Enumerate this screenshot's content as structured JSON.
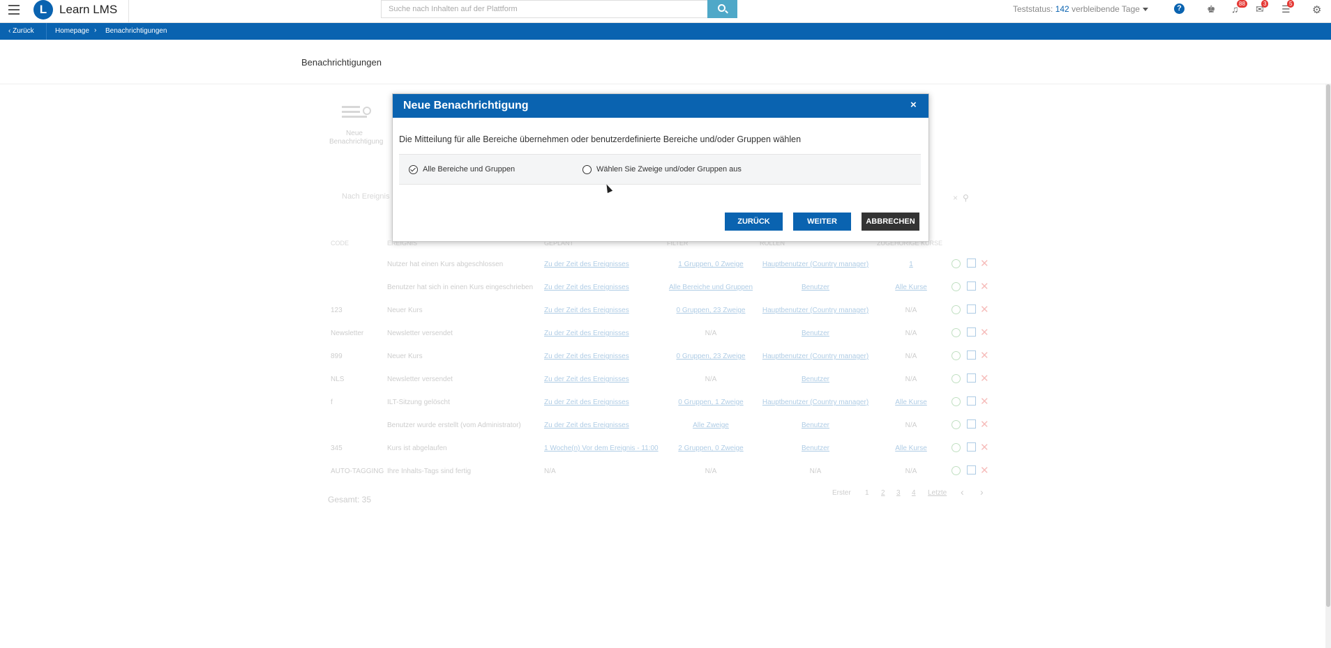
{
  "app": {
    "logo_letter": "L",
    "name": "Learn LMS"
  },
  "search": {
    "placeholder": "Suche nach Inhalten auf der Plattform"
  },
  "trial": {
    "prefix": "Teststatus:",
    "days": "142",
    "suffix": "verbleibende Tage"
  },
  "header_icons": {
    "help": "?",
    "trophy": "trophy-icon",
    "notifications_badge": "88",
    "chat_badge": "3",
    "messages_badge": "5"
  },
  "breadcrumb": {
    "back": "Zurück",
    "home": "Homepage",
    "current": "Benachrichtigungen"
  },
  "page": {
    "title": "Benachrichtigungen",
    "new_label": "Neue Benachrichtigung",
    "filter_placeholder": "Nach Ereignis"
  },
  "table": {
    "headers": [
      "CODE",
      "EREIGNIS",
      "GEPLANT",
      "FILTER",
      "ROLLEN",
      "ZUGEHÖRIGE KURSE"
    ],
    "rows": [
      {
        "code": "",
        "event": "Nutzer hat einen Kurs abgeschlossen",
        "scheduled": "Zu der Zeit des Ereignisses",
        "filter": "1 Gruppen, 0 Zweige",
        "roles": "Hauptbenutzer (Country manager)",
        "courses": "1"
      },
      {
        "code": "",
        "event": "Benutzer hat sich in einen Kurs eingeschrieben",
        "scheduled": "Zu der Zeit des Ereignisses",
        "filter": "Alle Bereiche und Gruppen",
        "roles": "Benutzer",
        "courses": "Alle Kurse"
      },
      {
        "code": "123",
        "event": "Neuer Kurs",
        "scheduled": "Zu der Zeit des Ereignisses",
        "filter": "0 Gruppen, 23 Zweige",
        "roles": "Hauptbenutzer (Country manager)",
        "courses": "N/A"
      },
      {
        "code": "Newsletter",
        "event": "Newsletter versendet",
        "scheduled": "Zu der Zeit des Ereignisses",
        "filter": "N/A",
        "roles": "Benutzer",
        "courses": "N/A"
      },
      {
        "code": "899",
        "event": "Neuer Kurs",
        "scheduled": "Zu der Zeit des Ereignisses",
        "filter": "0 Gruppen, 23 Zweige",
        "roles": "Hauptbenutzer (Country manager)",
        "courses": "N/A"
      },
      {
        "code": "NLS",
        "event": "Newsletter versendet",
        "scheduled": "Zu der Zeit des Ereignisses",
        "filter": "N/A",
        "roles": "Benutzer",
        "courses": "N/A"
      },
      {
        "code": "f",
        "event": "ILT-Sitzung gelöscht",
        "scheduled": "Zu der Zeit des Ereignisses",
        "filter": "0 Gruppen, 1 Zweige",
        "roles": "Hauptbenutzer (Country manager)",
        "courses": "Alle Kurse"
      },
      {
        "code": "",
        "event": "Benutzer wurde erstellt (vom Administrator)",
        "scheduled": "Zu der Zeit des Ereignisses",
        "filter": "Alle Zweige",
        "roles": "Benutzer",
        "courses": "N/A"
      },
      {
        "code": "345",
        "event": "Kurs ist abgelaufen",
        "scheduled": "1 Woche(n) Vor dem Ereignis - 11:00",
        "filter": "2 Gruppen, 0 Zweige",
        "roles": "Benutzer",
        "courses": "Alle Kurse"
      },
      {
        "code": "AUTO-TAGGING",
        "event": "Ihre Inhalts-Tags sind fertig",
        "scheduled": "N/A",
        "filter": "N/A",
        "roles": "N/A",
        "courses": "N/A"
      }
    ],
    "total": "Gesamt: 35"
  },
  "pagination": {
    "first": "Erster",
    "pages": [
      "1",
      "2",
      "3",
      "4"
    ],
    "last": "Letzte",
    "prev": "‹",
    "next": "›"
  },
  "modal": {
    "title": "Neue Benachrichtigung",
    "close": "×",
    "description": "Die Mitteilung für alle Bereiche übernehmen oder benutzerdefinierte Bereiche und/oder Gruppen wählen",
    "option_all": "Alle Bereiche und Gruppen",
    "option_custom": "Wählen Sie Zweige und/oder Gruppen aus",
    "selected": "all",
    "btn_back": "ZURÜCK",
    "btn_next": "WEITER",
    "btn_cancel": "ABBRECHEN"
  }
}
